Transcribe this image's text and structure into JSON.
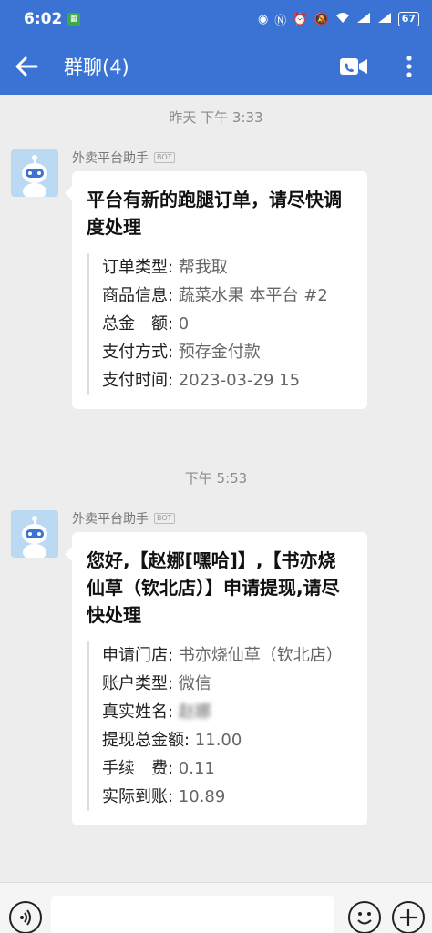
{
  "status": {
    "time": "6:02",
    "battery": "67"
  },
  "header": {
    "title": "群聊(4)"
  },
  "messages": [
    {
      "timestamp": "昨天  下午 3:33",
      "sender": "外卖平台助手",
      "sender_badge": "BOT",
      "headline": "平台有新的跑腿订单，请尽快调度处理",
      "fields": [
        {
          "label": "订单类型: ",
          "value": "帮我取"
        },
        {
          "label": "商品信息: ",
          "value": "蔬菜水果 本平台 #2"
        },
        {
          "label": "总金　额: ",
          "value": "0"
        },
        {
          "label": "支付方式: ",
          "value": "预存金付款"
        },
        {
          "label": "支付时间: ",
          "value": "2023-03-29 15"
        }
      ]
    },
    {
      "timestamp": "下午 5:53",
      "sender": "外卖平台助手",
      "sender_badge": "BOT",
      "headline": "您好,【赵娜[嘿哈]】,【书亦烧仙草（钦北店）】申请提现,请尽快处理",
      "fields": [
        {
          "label": "申请门店: ",
          "value": "书亦烧仙草（钦北店）"
        },
        {
          "label": "账户类型: ",
          "value": "微信"
        },
        {
          "label": "真实姓名: ",
          "value": "赵娜"
        },
        {
          "label": "提现总金额: ",
          "value": "11.00"
        },
        {
          "label": "手续　费: ",
          "value": "0.11"
        },
        {
          "label": "实际到账: ",
          "value": "10.89"
        }
      ]
    }
  ]
}
